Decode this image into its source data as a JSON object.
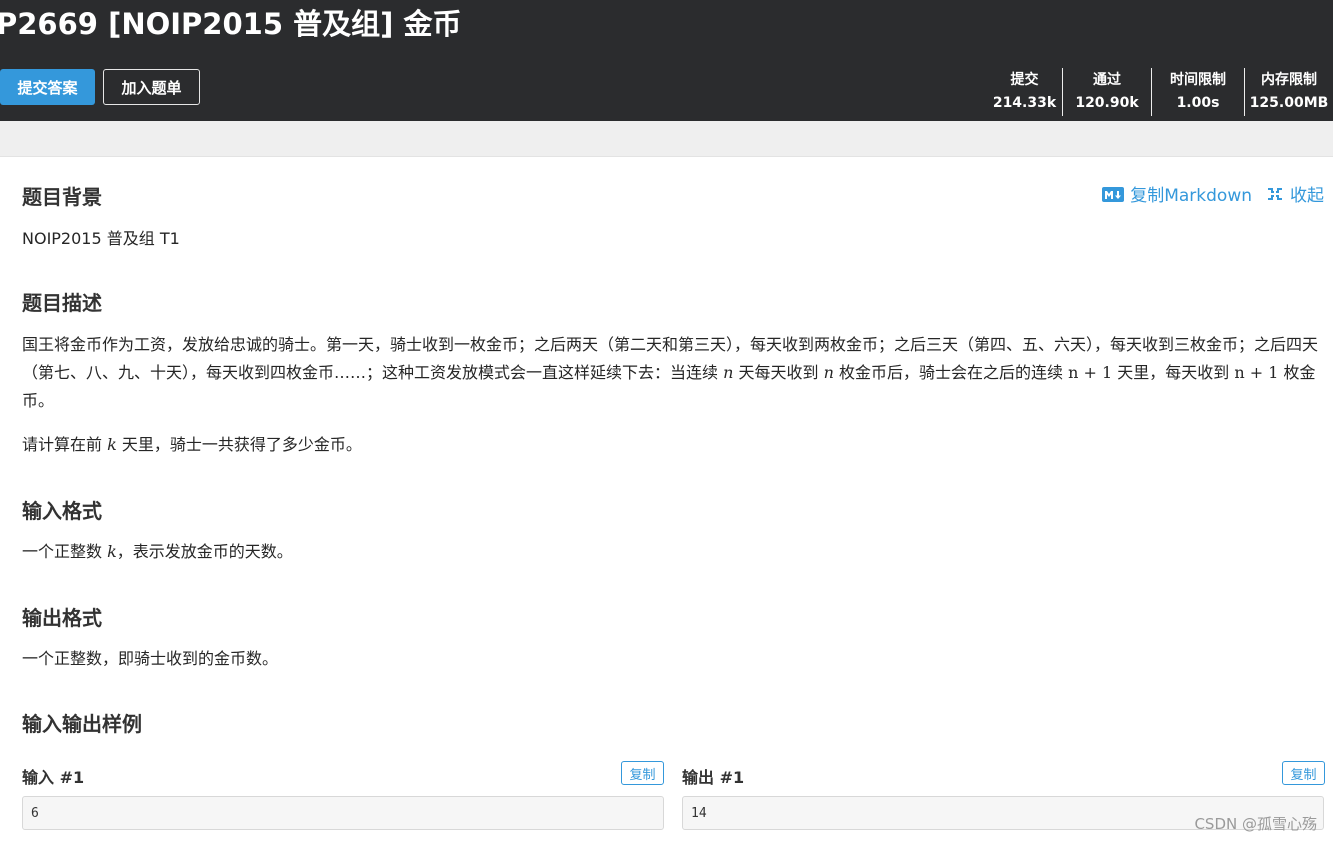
{
  "header": {
    "title": "P2669 [NOIP2015 普及组] 金币",
    "submit_label": "提交答案",
    "add_label": "加入题单",
    "stats": [
      {
        "label": "提交",
        "value": "214.33k"
      },
      {
        "label": "通过",
        "value": "120.90k"
      },
      {
        "label": "时间限制",
        "value": "1.00s"
      },
      {
        "label": "内存限制",
        "value": "125.00MB"
      }
    ]
  },
  "actions": {
    "copy_markdown": "复制Markdown",
    "collapse": "收起",
    "md_icon": "markdown-icon",
    "collapse_icon": "collapse-icon"
  },
  "sections": {
    "background": {
      "title": "题目背景",
      "text": "NOIP2015 普及组 T1"
    },
    "description": {
      "title": "题目描述",
      "p1": {
        "a": "国王将金币作为工资，发放给忠诚的骑士。第一天，骑士收到一枚金币；之后两天（第二天和第三天），每天收到两枚金币；之后三天（第四、五、六天），每天收到三枚金币；之后四天（第七、八、九、十天），每天收到四枚金币……；这种工资发放模式会一直这样延续下去：当连续 ",
        "m1": "n",
        "b": " 天每天收到 ",
        "m2": "n",
        "c": " 枚金币后，骑士会在之后的连续 ",
        "m3": "n + 1",
        "d": " 天里，每天收到 ",
        "m4": "n + 1",
        "e": " 枚金币。"
      },
      "p2": {
        "a": "请计算在前 ",
        "m1": "k",
        "b": " 天里，骑士一共获得了多少金币。"
      }
    },
    "input_format": {
      "title": "输入格式",
      "a": "一个正整数 ",
      "m1": "k",
      "b": "，表示发放金币的天数。"
    },
    "output_format": {
      "title": "输出格式",
      "text": "一个正整数，即骑士收到的金币数。"
    },
    "samples": {
      "title": "输入输出样例",
      "input_label": "输入 #1",
      "output_label": "输出 #1",
      "copy_label": "复制",
      "input_value": "6",
      "output_value": "14"
    }
  },
  "watermark": "CSDN @孤雪心殇"
}
